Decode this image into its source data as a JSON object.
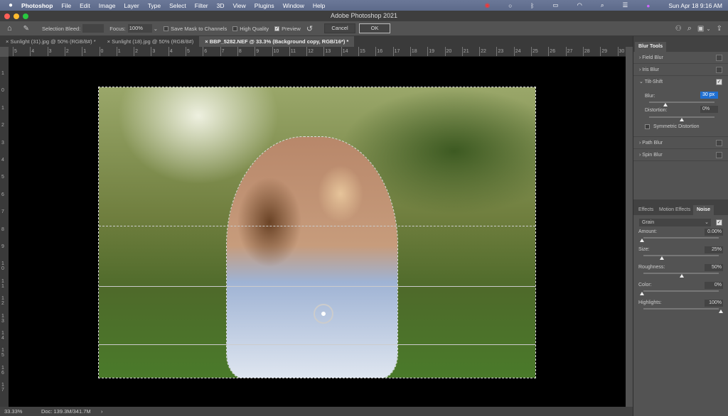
{
  "menubar": {
    "app": "Photoshop",
    "items": [
      "File",
      "Edit",
      "Image",
      "Layer",
      "Type",
      "Select",
      "Filter",
      "3D",
      "View",
      "Plugins",
      "Window",
      "Help"
    ],
    "clock": "Sun Apr 18  9:16 AM"
  },
  "window": {
    "title": "Adobe Photoshop 2021"
  },
  "options": {
    "selection_bleed": "Selection Bleed:",
    "focus_label": "Focus:",
    "focus_value": "100%",
    "save_mask": "Save Mask to Channels",
    "save_mask_checked": false,
    "high_quality": "High Quality",
    "high_quality_checked": false,
    "preview": "Preview",
    "preview_checked": true,
    "cancel": "Cancel",
    "ok": "OK"
  },
  "tabs": [
    {
      "label": "Sunlight (31).jpg @ 50% (RGB/8#) *"
    },
    {
      "label": "Sunlight (18).jpg @ 50% (RGB/8#)"
    },
    {
      "label": "BBP_5282.NEF @ 33.3% (Background copy, RGB/16*) *",
      "active": true
    }
  ],
  "ruler": {
    "h": [
      "5",
      "4",
      "3",
      "2",
      "1",
      "0",
      "1",
      "2",
      "3",
      "4",
      "5",
      "6",
      "7",
      "8",
      "9",
      "10",
      "11",
      "12",
      "13",
      "14",
      "15",
      "16",
      "17",
      "18",
      "19",
      "20",
      "21",
      "22",
      "23",
      "24",
      "25",
      "26",
      "27",
      "28",
      "29",
      "30"
    ],
    "v": [
      "1",
      "0",
      "1",
      "2",
      "3",
      "4",
      "5",
      "6",
      "7",
      "8",
      "9",
      "1\n0",
      "1\n1",
      "1\n2",
      "1\n3",
      "1\n4",
      "1\n5",
      "1\n6",
      "1\n7"
    ]
  },
  "statusbar": {
    "zoom": "33.33%",
    "doc": "Doc: 139.3M/341.7M",
    "arrow": "›"
  },
  "blur_tools": {
    "title": "Blur Tools",
    "items": [
      {
        "label": "Field Blur",
        "checked": false
      },
      {
        "label": "Iris Blur",
        "checked": false
      },
      {
        "label": "Tilt-Shift",
        "checked": true,
        "expanded": true
      },
      {
        "label": "Path Blur",
        "checked": false
      },
      {
        "label": "Spin Blur",
        "checked": false
      }
    ],
    "blur_label": "Blur:",
    "blur_value": "30 px",
    "blur_level": 0.25,
    "distortion_label": "Distortion:",
    "distortion_value": "0%",
    "distortion_level": 0.5,
    "symmetric": "Symmetric Distortion",
    "symmetric_checked": false
  },
  "effects": {
    "tabs": [
      "Effects",
      "Motion Effects",
      "Noise"
    ],
    "active_tab": "Noise",
    "type": "Grain",
    "enabled": true,
    "sliders": [
      {
        "label": "Amount:",
        "value": "0.00%",
        "level": 0
      },
      {
        "label": "Size:",
        "value": "25%",
        "level": 0.25
      },
      {
        "label": "Roughness:",
        "value": "50%",
        "level": 0.5
      },
      {
        "label": "Color:",
        "value": "0%",
        "level": 0
      },
      {
        "label": "Highlights:",
        "value": "100%",
        "level": 1
      }
    ]
  },
  "colors": {
    "accent": "#1f6fd1",
    "panel": "#535353",
    "canvas": "#000000"
  }
}
